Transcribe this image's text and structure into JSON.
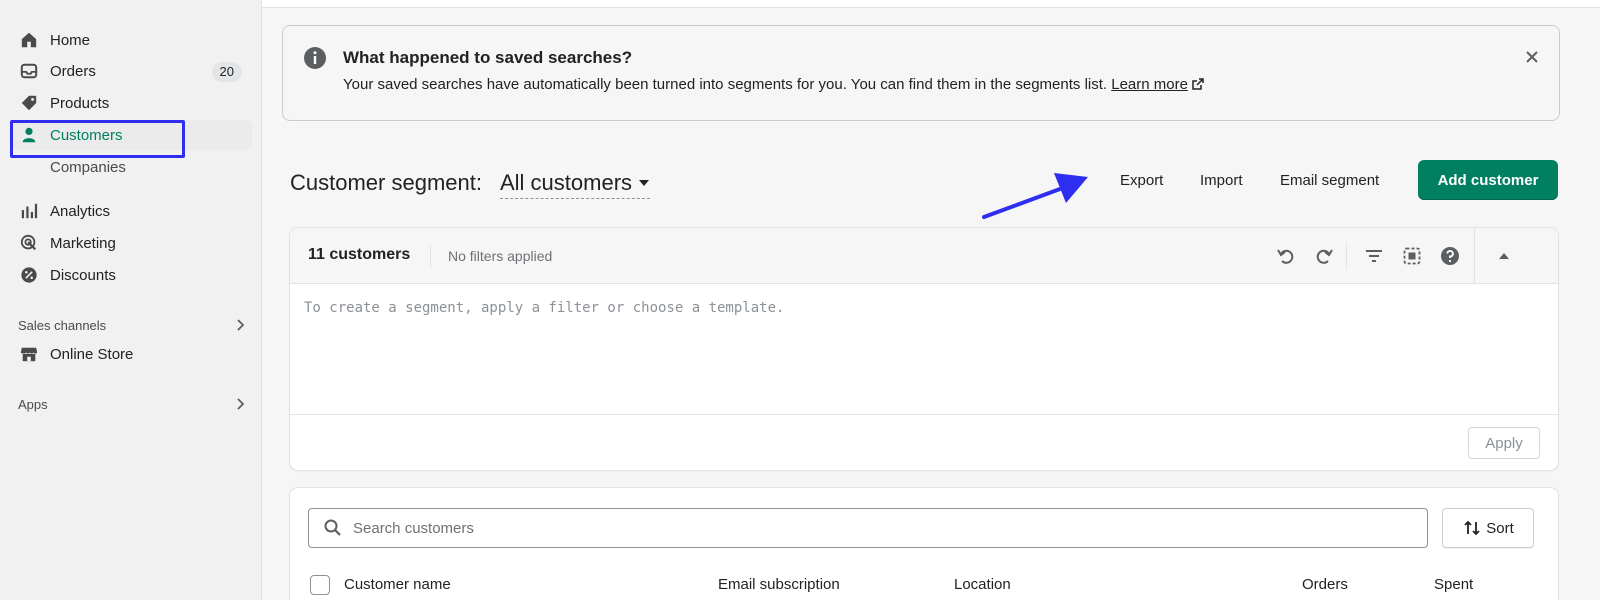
{
  "sidebar": {
    "items": [
      {
        "label": "Home",
        "icon": "home-icon"
      },
      {
        "label": "Orders",
        "icon": "inbox-icon",
        "badge": "20"
      },
      {
        "label": "Products",
        "icon": "tag-icon"
      },
      {
        "label": "Customers",
        "icon": "person-icon",
        "active": true
      },
      {
        "label": "Companies"
      },
      {
        "label": "Analytics",
        "icon": "bar-chart-icon"
      },
      {
        "label": "Marketing",
        "icon": "target-icon"
      },
      {
        "label": "Discounts",
        "icon": "discount-icon"
      }
    ],
    "sales_channels": {
      "label": "Sales channels",
      "items": [
        {
          "label": "Online Store",
          "icon": "store-icon"
        }
      ]
    },
    "apps": {
      "label": "Apps"
    }
  },
  "banner": {
    "title": "What happened to saved searches?",
    "body": "Your saved searches have automatically been turned into segments for you. You can find them in the segments list.",
    "link": "Learn more"
  },
  "header": {
    "segment_label": "Customer segment:",
    "segment_value": "All customers",
    "actions": {
      "export": "Export",
      "import": "Import",
      "email_segment": "Email segment"
    },
    "primary": "Add customer"
  },
  "editor": {
    "count": "11 customers",
    "filters": "No filters applied",
    "placeholder": "To create a segment, apply a filter or choose a template.",
    "apply": "Apply"
  },
  "list": {
    "search_placeholder": "Search customers",
    "sort": "Sort",
    "columns": [
      "Customer name",
      "Email subscription",
      "Location",
      "Orders",
      "Spent"
    ]
  },
  "colors": {
    "brand_green": "#008060",
    "annotation_blue": "#2d2ef0"
  }
}
